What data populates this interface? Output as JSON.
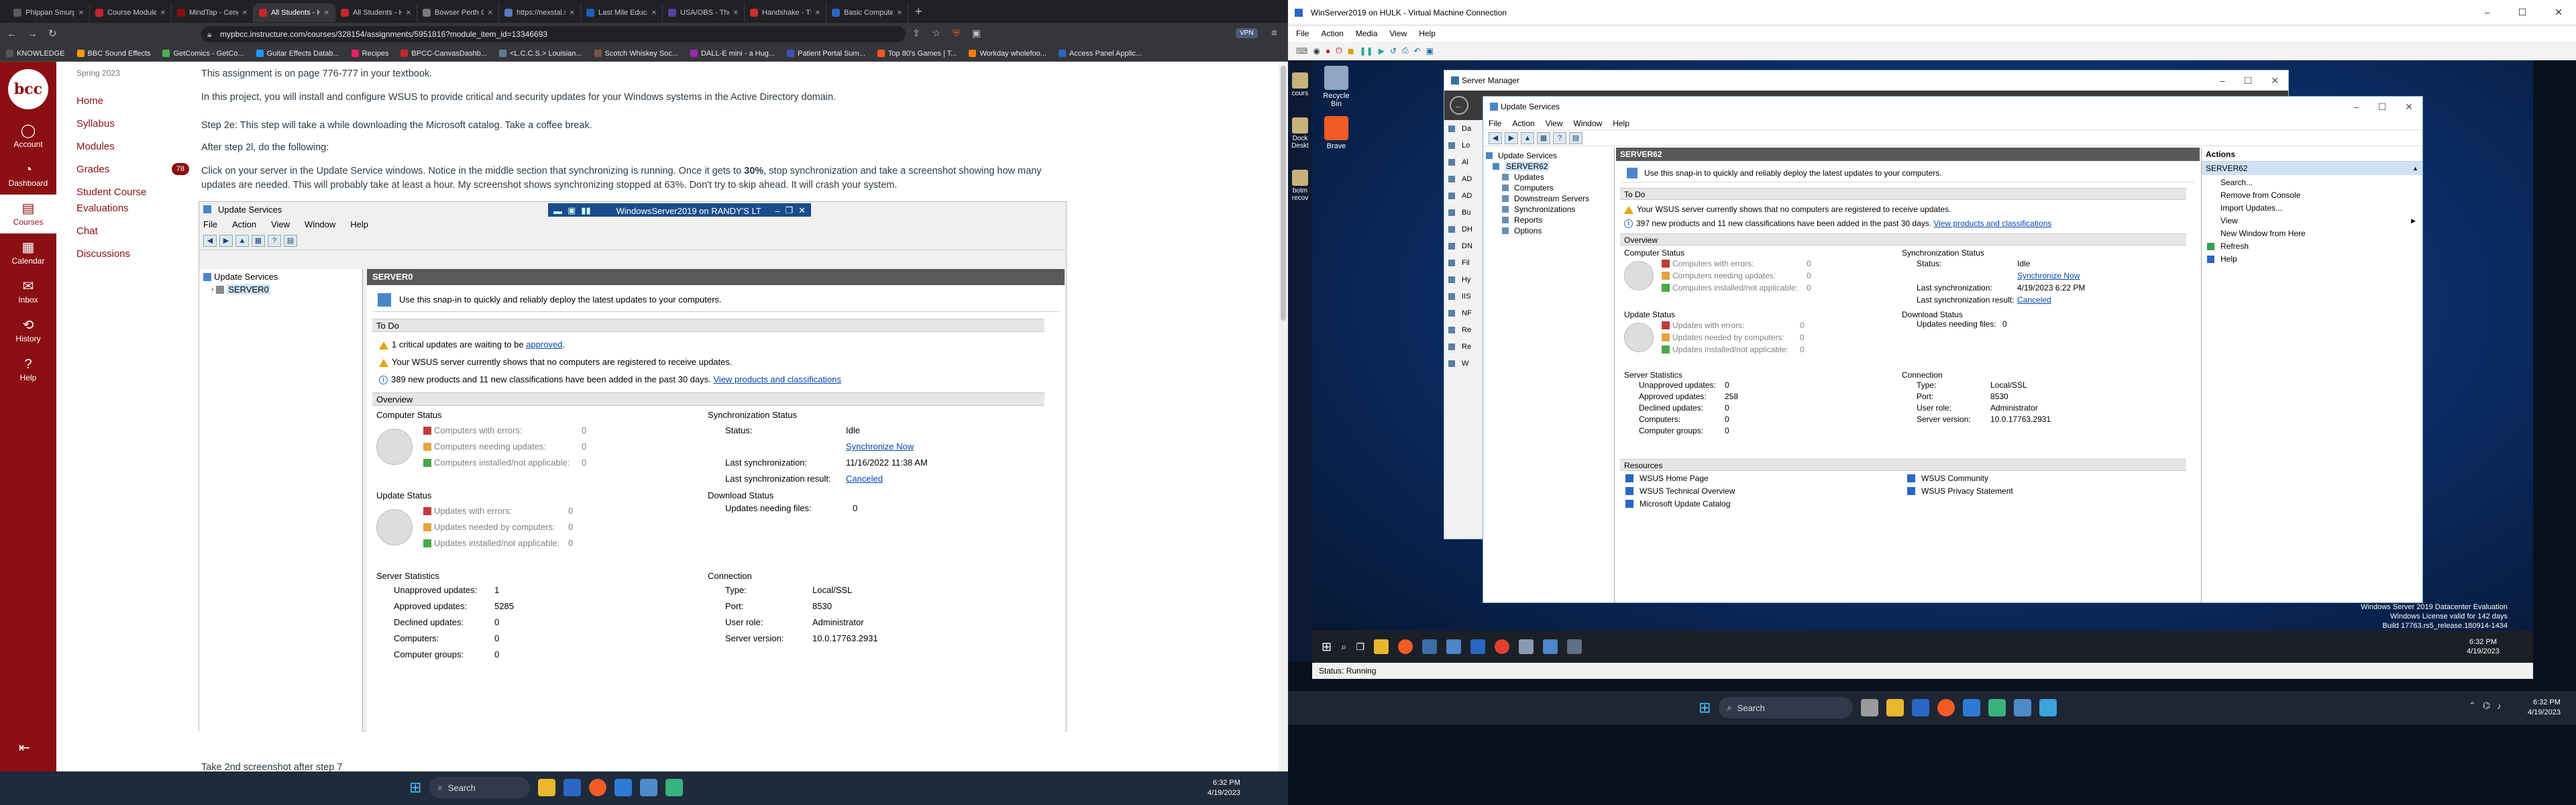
{
  "browser": {
    "tabs": [
      {
        "label": "Phippan Smurph",
        "color": "#5a5a5a"
      },
      {
        "label": "Course Modules: Mi",
        "color": "#c4262e"
      },
      {
        "label": "MindTap - Cengage",
        "color": "#8b0e12"
      },
      {
        "label": "All Students - Ha",
        "color": "#c4262e",
        "active": true
      },
      {
        "label": "All Students - Hamb",
        "color": "#c4262e"
      },
      {
        "label": "Bowser Perth Co",
        "color": "#7a7a7a"
      },
      {
        "label": "https://nexstal.sell/",
        "color": "#5a7ac0"
      },
      {
        "label": "Last Mile Education",
        "color": "#1f5fbf"
      },
      {
        "label": "USA/OBS - The Fin",
        "color": "#5b3ea0"
      },
      {
        "label": "Handshake - The N",
        "color": "#cc2d2d"
      },
      {
        "label": "Basic Computer Sk",
        "color": "#2b67c5"
      }
    ],
    "url": "mypbcc.instructure.com/courses/328154/assignments/5951816?module_item_id=13346693",
    "vpn": "VPN",
    "bookmarks": [
      "KNOWLEDGE",
      "BBC Sound Effects",
      "GetComics - GetCo...",
      "Guitar Effects Datab...",
      "Recipes",
      "BPCC-CanvasDashb...",
      "<L.C.C.S.> Louisian...",
      "Scotch Whiskey Soc...",
      "DALL-E mini - a Hug...",
      "Patient Portal Sum...",
      "Top 80's Games | T...",
      "Workday wholefoo...",
      "Access Panel Applic..."
    ]
  },
  "canvas_nav": {
    "logo": "bcc",
    "items": [
      {
        "label": "Account",
        "icon": "account-icon",
        "glyph": "◯"
      },
      {
        "label": "Dashboard",
        "icon": "dashboard-icon",
        "glyph": "◔"
      },
      {
        "label": "Courses",
        "icon": "courses-icon",
        "glyph": "▤",
        "active": true
      },
      {
        "label": "Calendar",
        "icon": "calendar-icon",
        "glyph": "▦"
      },
      {
        "label": "Inbox",
        "icon": "inbox-icon",
        "glyph": "✉"
      },
      {
        "label": "History",
        "icon": "history-icon",
        "glyph": "⟲"
      },
      {
        "label": "Help",
        "icon": "help-icon",
        "glyph": "?"
      }
    ],
    "collapse_glyph": "⇤"
  },
  "course_nav": {
    "term": "Spring 2023",
    "items": [
      "Home",
      "Syllabus",
      "Modules",
      "Grades",
      "Student Course Evaluations",
      "Chat",
      "Discussions"
    ],
    "grades_badge": "78"
  },
  "content": {
    "p1": "This assignment is on page 776-777 in your textbook.",
    "p2": "In this project, you will install and configure WSUS to provide critical and security updates for your Windows systems in the Active Directory domain.",
    "p3": "Step 2e: This step will take a while downloading the Microsoft catalog. Take a coffee break.",
    "p4": "After step 2l, do the following:",
    "p5a": "Click on your server in the Update Service windows. Notice in the middle section that synchronizing is running. Once it gets to",
    "p5b": "30%",
    "p5c": ", stop synchronization and  take a screenshot showing how many updates are needed. This will probably take at least a hour. My screenshot shows synchronizing stopped at 63%. Don't try to skip ahead. It will crash your system.",
    "bottom": "Take 2nd screenshot after step 7"
  },
  "shot": {
    "title": "Update Services",
    "menu": [
      "File",
      "Action",
      "View",
      "Window",
      "Help"
    ],
    "vm_pill": "WindowsServer2019 on RANDY'S LT",
    "tree_root": "Update Services",
    "tree_server": "SERVER0",
    "server_heading": "SERVER0",
    "banner": "Use this snap-in to quickly and reliably deploy the latest updates to your computers.",
    "todo_header": "To Do",
    "todo1a": "1 critical updates are waiting to be",
    "todo1b": "approved",
    "todo2": "Your WSUS server currently shows that no computers are registered to receive updates.",
    "todo3a": "389 new products and 11 new classifications have been added in the past 30 days.",
    "todo3b": "View products and classifications",
    "overview_header": "Overview",
    "computer_status": "Computer Status",
    "cs_rows": [
      {
        "label": "Computers with errors:",
        "value": "0",
        "color": "#c23b3b"
      },
      {
        "label": "Computers needing updates:",
        "value": "0",
        "color": "#e2a440"
      },
      {
        "label": "Computers installed/not applicable:",
        "value": "0",
        "color": "#48a84a"
      }
    ],
    "sync_status": "Synchronization Status",
    "sync_rows": [
      {
        "label": "Status:",
        "value": "Idle",
        "link": false
      },
      {
        "label": "",
        "value": "Synchronize Now",
        "link": true
      },
      {
        "label": "Last synchronization:",
        "value": "11/16/2022 11:38 AM",
        "link": false
      },
      {
        "label": "Last synchronization result:",
        "value": "Canceled",
        "link": true
      }
    ],
    "update_status": "Update Status",
    "us_rows": [
      {
        "label": "Updates with errors:",
        "value": "0",
        "color": "#c23b3b"
      },
      {
        "label": "Updates needed by computers:",
        "value": "0",
        "color": "#e2a440"
      },
      {
        "label": "Updates installed/not applicable:",
        "value": "0",
        "color": "#48a84a"
      }
    ],
    "download_status": "Download Status",
    "download_label": "Updates needing files:",
    "download_value": "0",
    "server_stats": "Server Statistics",
    "stats_rows": [
      {
        "label": "Unapproved updates:",
        "value": "1"
      },
      {
        "label": "Approved updates:",
        "value": "5285"
      },
      {
        "label": "Declined updates:",
        "value": "0"
      },
      {
        "label": "Computers:",
        "value": "0"
      },
      {
        "label": "Computer groups:",
        "value": "0"
      }
    ],
    "connection": "Connection",
    "conn_rows": [
      {
        "label": "Type:",
        "value": "Local/SSL"
      },
      {
        "label": "Port:",
        "value": "8530"
      },
      {
        "label": "User role:",
        "value": "Administrator"
      },
      {
        "label": "Server version:",
        "value": "10.0.17763.2931"
      }
    ]
  },
  "left_taskbar": {
    "search": "Search",
    "time": "6:32 PM",
    "date": "4/19/2023"
  },
  "vm": {
    "title": "WinServer2019 on HULK - Virtual Machine Connection",
    "menu": [
      "File",
      "Action",
      "Media",
      "View",
      "Help"
    ],
    "desktop_icons": [
      {
        "label": "Recycle Bin",
        "color": "#8fa7c2"
      },
      {
        "label": "Brave",
        "color": "#f25b24"
      }
    ],
    "left_partial_icons": [
      "cours",
      "Dock Deskt",
      "botm recov"
    ],
    "sm_title": "Server Manager",
    "us_title": "Update Services",
    "us_menu": [
      "File",
      "Action",
      "View",
      "Window",
      "Help"
    ],
    "tree": [
      "Update Services",
      "SERVER62",
      "Updates",
      "Computers",
      "Downstream Servers",
      "Synchronizations",
      "Reports",
      "Options"
    ],
    "heading": "SERVER62",
    "banner": "Use this snap-in to quickly and reliably deploy the latest updates to your computers.",
    "todo_header": "To Do",
    "todo1": "Your WSUS server currently shows that no computers are registered to receive updates.",
    "todo2a": "397 new products and 11 new classifications have been added in the past 30 days.",
    "todo2b": "View products and classifications",
    "overview": "Overview",
    "computer_status": "Computer Status",
    "cs_rows": [
      {
        "label": "Computers with errors:",
        "value": "0"
      },
      {
        "label": "Computers needing updates:",
        "value": "0"
      },
      {
        "label": "Computers installed/not applicable:",
        "value": "0"
      }
    ],
    "sync_status": "Synchronization Status",
    "sync_rows": [
      {
        "label": "Status:",
        "value": "Idle",
        "link": false
      },
      {
        "label": "",
        "value": "Synchronize Now",
        "link": true
      },
      {
        "label": "Last synchronization:",
        "value": "4/19/2023 6:22 PM",
        "link": false
      },
      {
        "label": "Last synchronization result:",
        "value": "Canceled",
        "link": true
      }
    ],
    "update_status": "Update Status",
    "us_rows": [
      {
        "label": "Updates with errors:",
        "value": "0"
      },
      {
        "label": "Updates needed by computers:",
        "value": "0"
      },
      {
        "label": "Updates installed/not applicable:",
        "value": "0"
      }
    ],
    "download_status": "Download Status",
    "download_label": "Updates needing files:",
    "download_value": "0",
    "server_stats": "Server Statistics",
    "stats_rows": [
      {
        "label": "Unapproved updates:",
        "value": "0"
      },
      {
        "label": "Approved updates:",
        "value": "258"
      },
      {
        "label": "Declined updates:",
        "value": "0"
      },
      {
        "label": "Computers:",
        "value": "0"
      },
      {
        "label": "Computer groups:",
        "value": "0"
      }
    ],
    "connection": "Connection",
    "conn_rows": [
      {
        "label": "Type:",
        "value": "Local/SSL"
      },
      {
        "label": "Port:",
        "value": "8530"
      },
      {
        "label": "User role:",
        "value": "Administrator"
      },
      {
        "label": "Server version:",
        "value": "10.0.17763.2931"
      }
    ],
    "resources": "Resources",
    "resources_items": [
      "WSUS Home Page",
      "WSUS Technical Overview",
      "Microsoft Update Catalog",
      "WSUS Community",
      "WSUS Privacy Statement"
    ],
    "actions_header": "Actions",
    "actions_sub": "SERVER62",
    "actions": [
      "Search...",
      "Remove from Console",
      "Import Updates...",
      "View",
      "New Window from Here",
      "Refresh",
      "Help"
    ],
    "sm_side": [
      "Da",
      "Lo",
      "Al",
      "AD",
      "AD",
      "Bu",
      "DH",
      "DN",
      "Fil",
      "Hy",
      "IIS",
      "NF",
      "Re",
      "Re",
      "W"
    ],
    "watermark1": "Windows Server 2019 Datacenter Evaluation",
    "watermark2": "Windows License valid for 142 days",
    "watermark3": "Build 17763.rs5_release.180914-1434",
    "vm_time": "6:32 PM",
    "vm_date": "4/19/2023",
    "status": "Status: Running"
  },
  "right_taskbar": {
    "search": "Search",
    "time": "6:32 PM",
    "date": "4/19/2023"
  }
}
